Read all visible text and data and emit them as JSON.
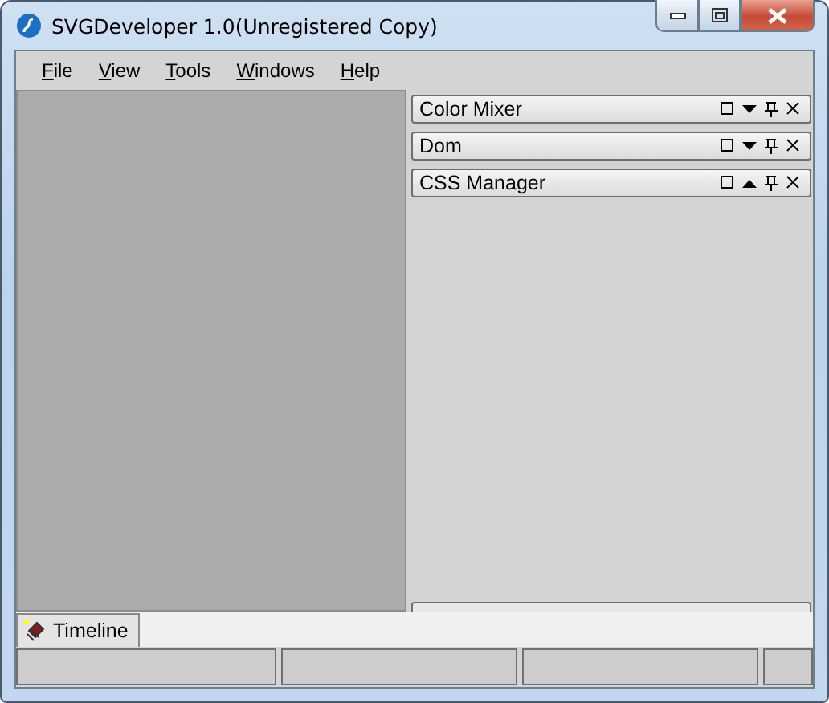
{
  "window": {
    "title": "SVGDeveloper 1.0(Unregistered Copy)"
  },
  "menu": [
    "File",
    "View",
    "Tools",
    "Windows",
    "Help"
  ],
  "panels": [
    {
      "title": "Color Mixer",
      "expanded": false
    },
    {
      "title": "Dom",
      "expanded": false
    },
    {
      "title": "CSS Manager",
      "expanded": true
    }
  ],
  "bottom_tabs": [
    {
      "label": "Timeline",
      "selected": true
    }
  ]
}
